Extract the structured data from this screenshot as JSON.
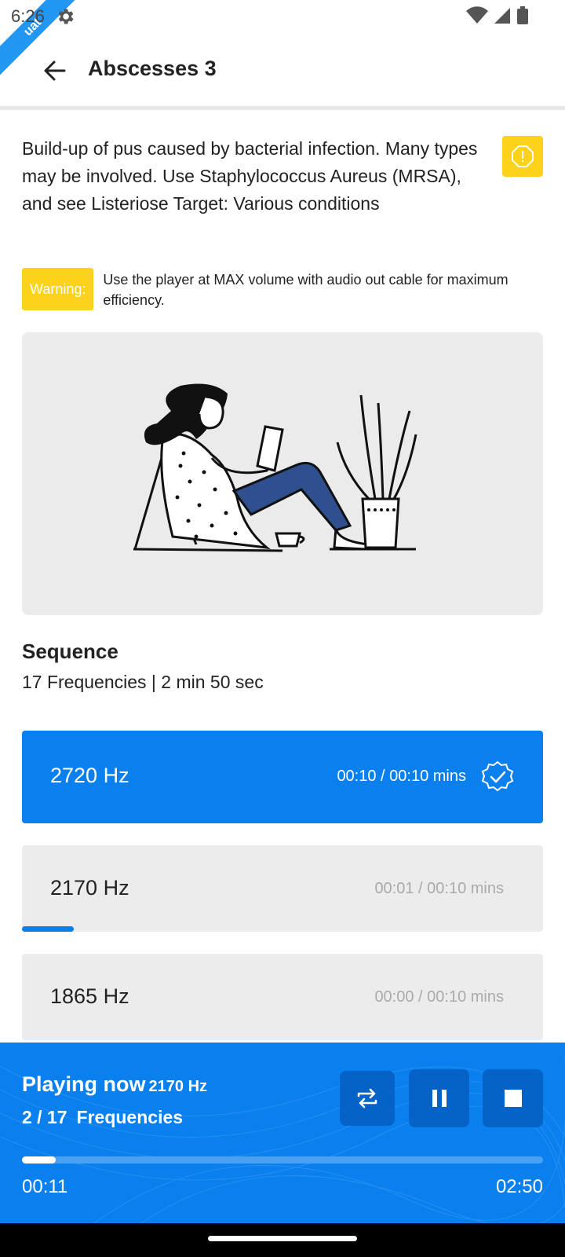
{
  "status_bar": {
    "time": "6:26",
    "icons": [
      "gear-icon",
      "wifi-icon",
      "signal-icon",
      "battery-icon"
    ],
    "ribbon": "uat"
  },
  "app_bar": {
    "title": "Abscesses 3",
    "back_icon": "arrow-left-icon"
  },
  "description": "Build-up of pus caused by bacterial infection. Many types may be involved. Use Staphylococcus Aureus (MRSA), and see Listeriose Target: Various conditions",
  "info_icon": "alert-octagon-icon",
  "warning": {
    "label": "Warning:",
    "text": "Use the player at MAX volume with audio out cable for maximum efficiency."
  },
  "illustration": "woman-reading-with-plant-illustration",
  "sequence": {
    "title": "Sequence",
    "subtitle": "17 Frequencies | 2 min 50 sec"
  },
  "frequencies": [
    {
      "hz": "2720 Hz",
      "time": "00:10 / 00:10 mins",
      "state": "completed"
    },
    {
      "hz": "2170 Hz",
      "time": "00:01 / 00:10 mins",
      "state": "playing",
      "progress": 0.1
    },
    {
      "hz": "1865 Hz",
      "time": "00:00 / 00:10 mins",
      "state": "pending"
    }
  ],
  "player": {
    "playing_label": "Playing now",
    "playing_hz": "2170 Hz",
    "count": "2 / 17",
    "count_label": "Frequencies",
    "elapsed": "00:11",
    "total": "02:50",
    "progress": 0.065,
    "controls": [
      "repeat-icon",
      "pause-icon",
      "stop-icon"
    ]
  },
  "colors": {
    "accent": "#0a7fee",
    "accent_dark": "#0563c7",
    "warning": "#fdd21b",
    "card_bg": "#ececec"
  }
}
